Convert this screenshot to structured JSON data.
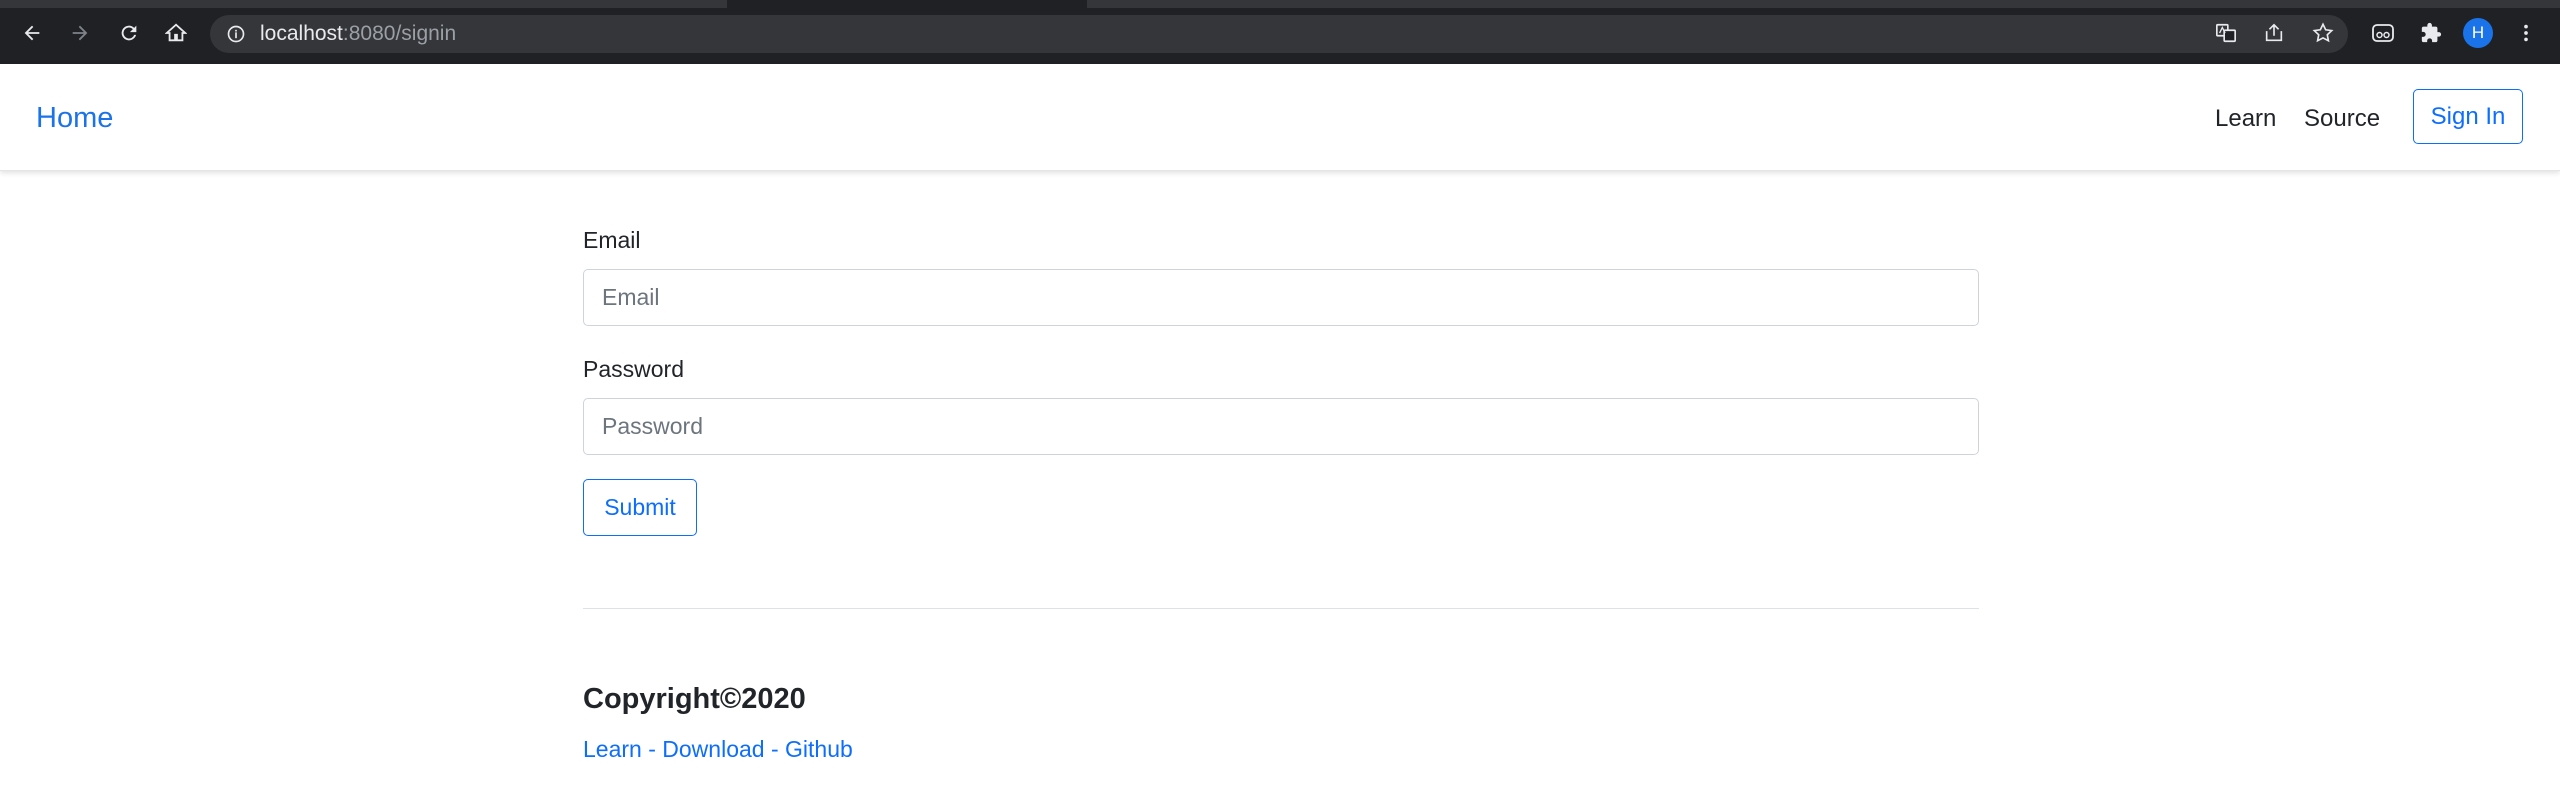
{
  "browser": {
    "url_host": "localhost",
    "url_rest": ":8080/signin",
    "profile_initial": "H"
  },
  "navbar": {
    "brand": "Home",
    "links": [
      "Learn",
      "Source"
    ],
    "signin_label": "Sign In"
  },
  "form": {
    "email_label": "Email",
    "email_placeholder": "Email",
    "email_value": "",
    "password_label": "Password",
    "password_placeholder": "Password",
    "password_value": "",
    "submit_label": "Submit"
  },
  "footer": {
    "copyright": "Copyright©2020",
    "links": [
      "Learn",
      "Download",
      "Github"
    ],
    "separator": "-"
  },
  "colors": {
    "accent": "#0d6efd",
    "chrome_bg": "#202124",
    "text": "#212529"
  }
}
